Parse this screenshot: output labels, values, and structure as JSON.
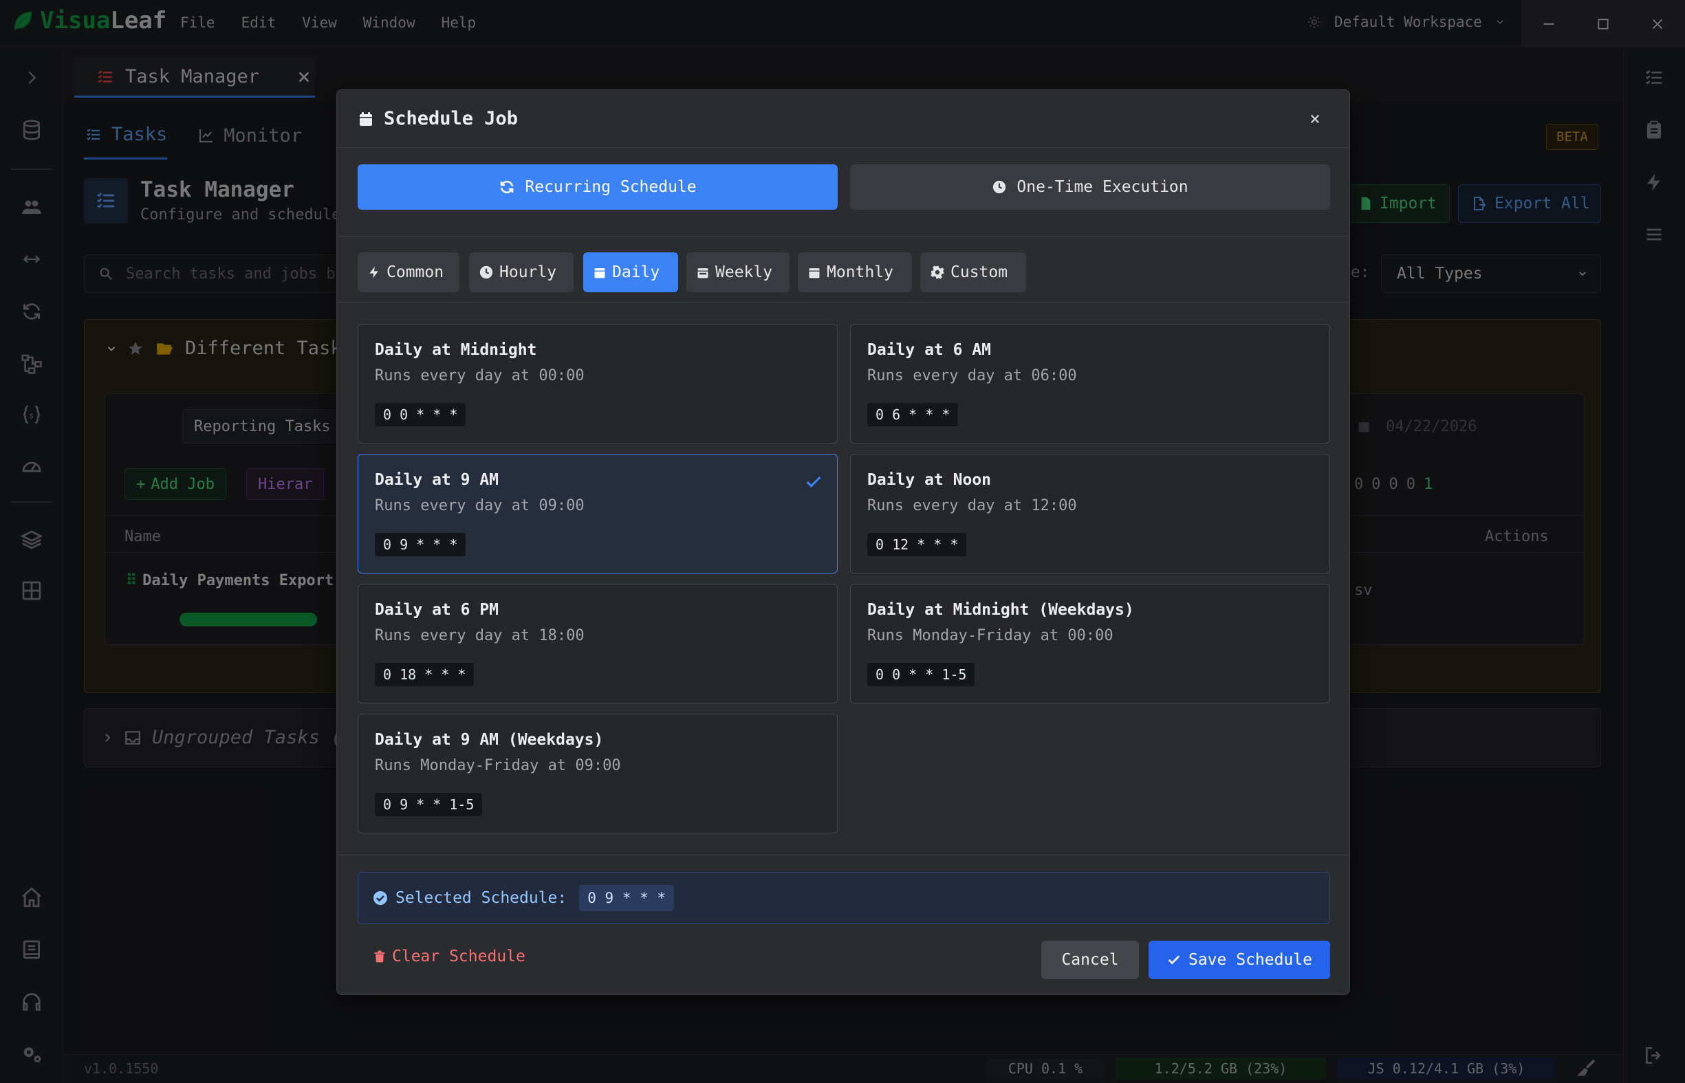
{
  "app": {
    "logo_part1": "Visua",
    "logo_part2": "Leaf",
    "menu": [
      "File",
      "Edit",
      "View",
      "Window",
      "Help"
    ],
    "workspace": "Default Workspace"
  },
  "background": {
    "doc_tab": "Task Manager",
    "sub_tabs": [
      "Tasks",
      "Monitor"
    ],
    "beta": "BETA",
    "header_title": "Task Manager",
    "header_subtitle": "Configure and schedule",
    "search_placeholder": "Search tasks and jobs b",
    "type_label": "pe:",
    "type_select": "All Types",
    "import_label": "Import",
    "export_label": "Export All",
    "group_title": "Different Tasks",
    "inner_group_name": "Reporting Tasks",
    "date_text": "04/22/2026",
    "add_job": "Add Job",
    "hierarchy": "Hierar",
    "col_name": "Name",
    "col_actions": "Actions",
    "row_name": "Daily Payments Export",
    "row_trail": "sv",
    "counts": [
      "0",
      "0",
      "0",
      "0",
      "1"
    ],
    "ungrouped": "Ungrouped Tasks (",
    "status_version": "v1.0.1550",
    "status_cpu": "CPU 0.1 %",
    "status_mem": "1.2/5.2 GB (23%)",
    "status_js": "JS 0.12/4.1 GB (3%)"
  },
  "modal": {
    "title": "Schedule Job",
    "mode_recurring": "Recurring Schedule",
    "mode_once": "One-Time Execution",
    "categories": [
      "Common",
      "Hourly",
      "Daily",
      "Weekly",
      "Monthly",
      "Custom"
    ],
    "active_category": "Daily",
    "presets": [
      {
        "title": "Daily at Midnight",
        "desc": "Runs every day at 00:00",
        "cron": "0 0 * * *"
      },
      {
        "title": "Daily at 6 AM",
        "desc": "Runs every day at 06:00",
        "cron": "0 6 * * *"
      },
      {
        "title": "Daily at 9 AM",
        "desc": "Runs every day at 09:00",
        "cron": "0 9 * * *"
      },
      {
        "title": "Daily at Noon",
        "desc": "Runs every day at 12:00",
        "cron": "0 12 * * *"
      },
      {
        "title": "Daily at 6 PM",
        "desc": "Runs every day at 18:00",
        "cron": "0 18 * * *"
      },
      {
        "title": "Daily at Midnight (Weekdays)",
        "desc": "Runs Monday-Friday at 00:00",
        "cron": "0 0 * * 1-5"
      },
      {
        "title": "Daily at 9 AM (Weekdays)",
        "desc": "Runs Monday-Friday at 09:00",
        "cron": "0 9 * * 1-5"
      }
    ],
    "selected_label": "Selected Schedule:",
    "selected_cron": "0 9 * * *",
    "clear_label": "Clear Schedule",
    "cancel_label": "Cancel",
    "save_label": "Save Schedule"
  }
}
